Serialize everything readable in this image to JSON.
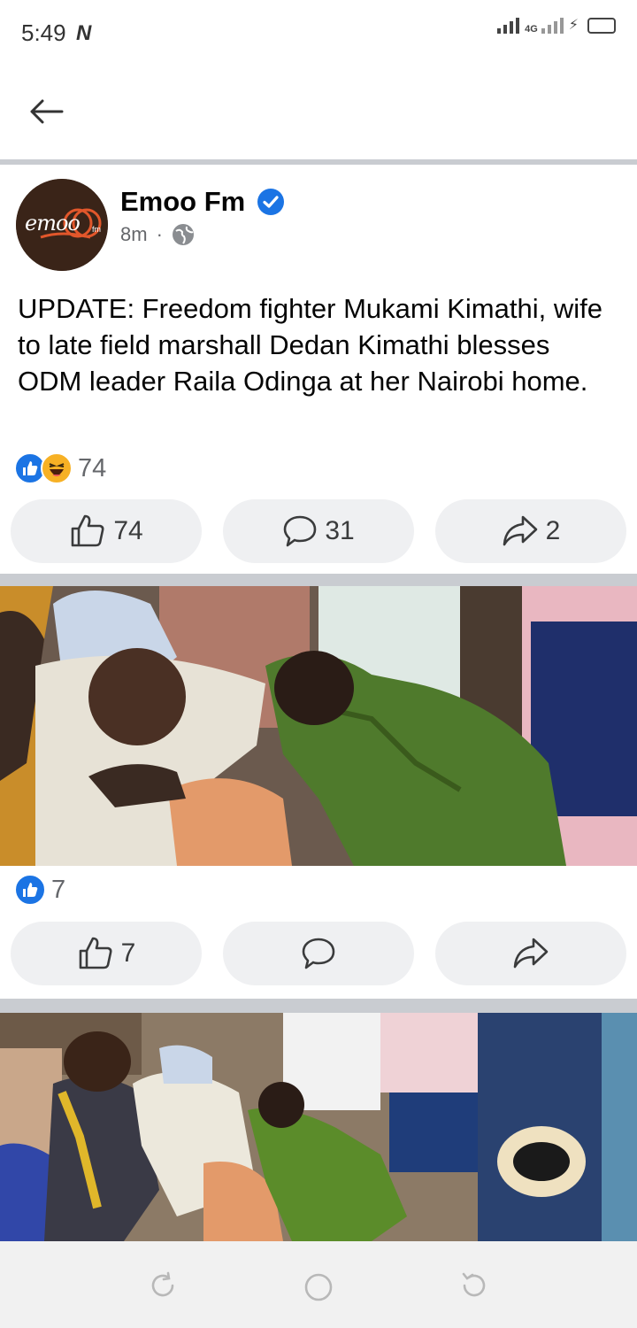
{
  "status_bar": {
    "time": "5:49",
    "notification_glyph": "N",
    "network_label": "4G",
    "icons": [
      "signal-icon",
      "network-signal-icon",
      "charging-icon",
      "battery-icon"
    ]
  },
  "app_bar": {
    "back_icon": "arrow-left-icon"
  },
  "post": {
    "page_name": "Emoo Fm",
    "verified_icon": "verified-badge-icon",
    "time_ago": "8m",
    "separator": "·",
    "audience_icon": "globe-icon",
    "avatar_logo_text": "emoo",
    "avatar_logo_suffix": "fm",
    "text": "UPDATE: Freedom fighter Mukami Kimathi, wife to late field marshall Dedan Kimathi blesses ODM leader Raila Odinga at her Nairobi home.",
    "reactions": {
      "icons": [
        "like-reaction-icon",
        "haha-reaction-icon"
      ],
      "count": "74"
    },
    "actions": {
      "like_count": "74",
      "comment_count": "31",
      "share_count": "2"
    }
  },
  "photos": [
    {
      "description_icon": "photo-1",
      "reactions": {
        "icons": [
          "like-reaction-icon"
        ],
        "count": "7"
      },
      "actions": {
        "like_count": "7",
        "comment_count": "",
        "share_count": ""
      }
    },
    {
      "description_icon": "photo-2"
    }
  ],
  "nav_bar": {
    "icons": [
      "recents-icon",
      "home-icon",
      "back-nav-icon"
    ]
  },
  "colors": {
    "accent": "#1b74e4",
    "button_bg": "#eff0f2",
    "separator": "#c9ccd1",
    "secondary_text": "#65676b"
  }
}
